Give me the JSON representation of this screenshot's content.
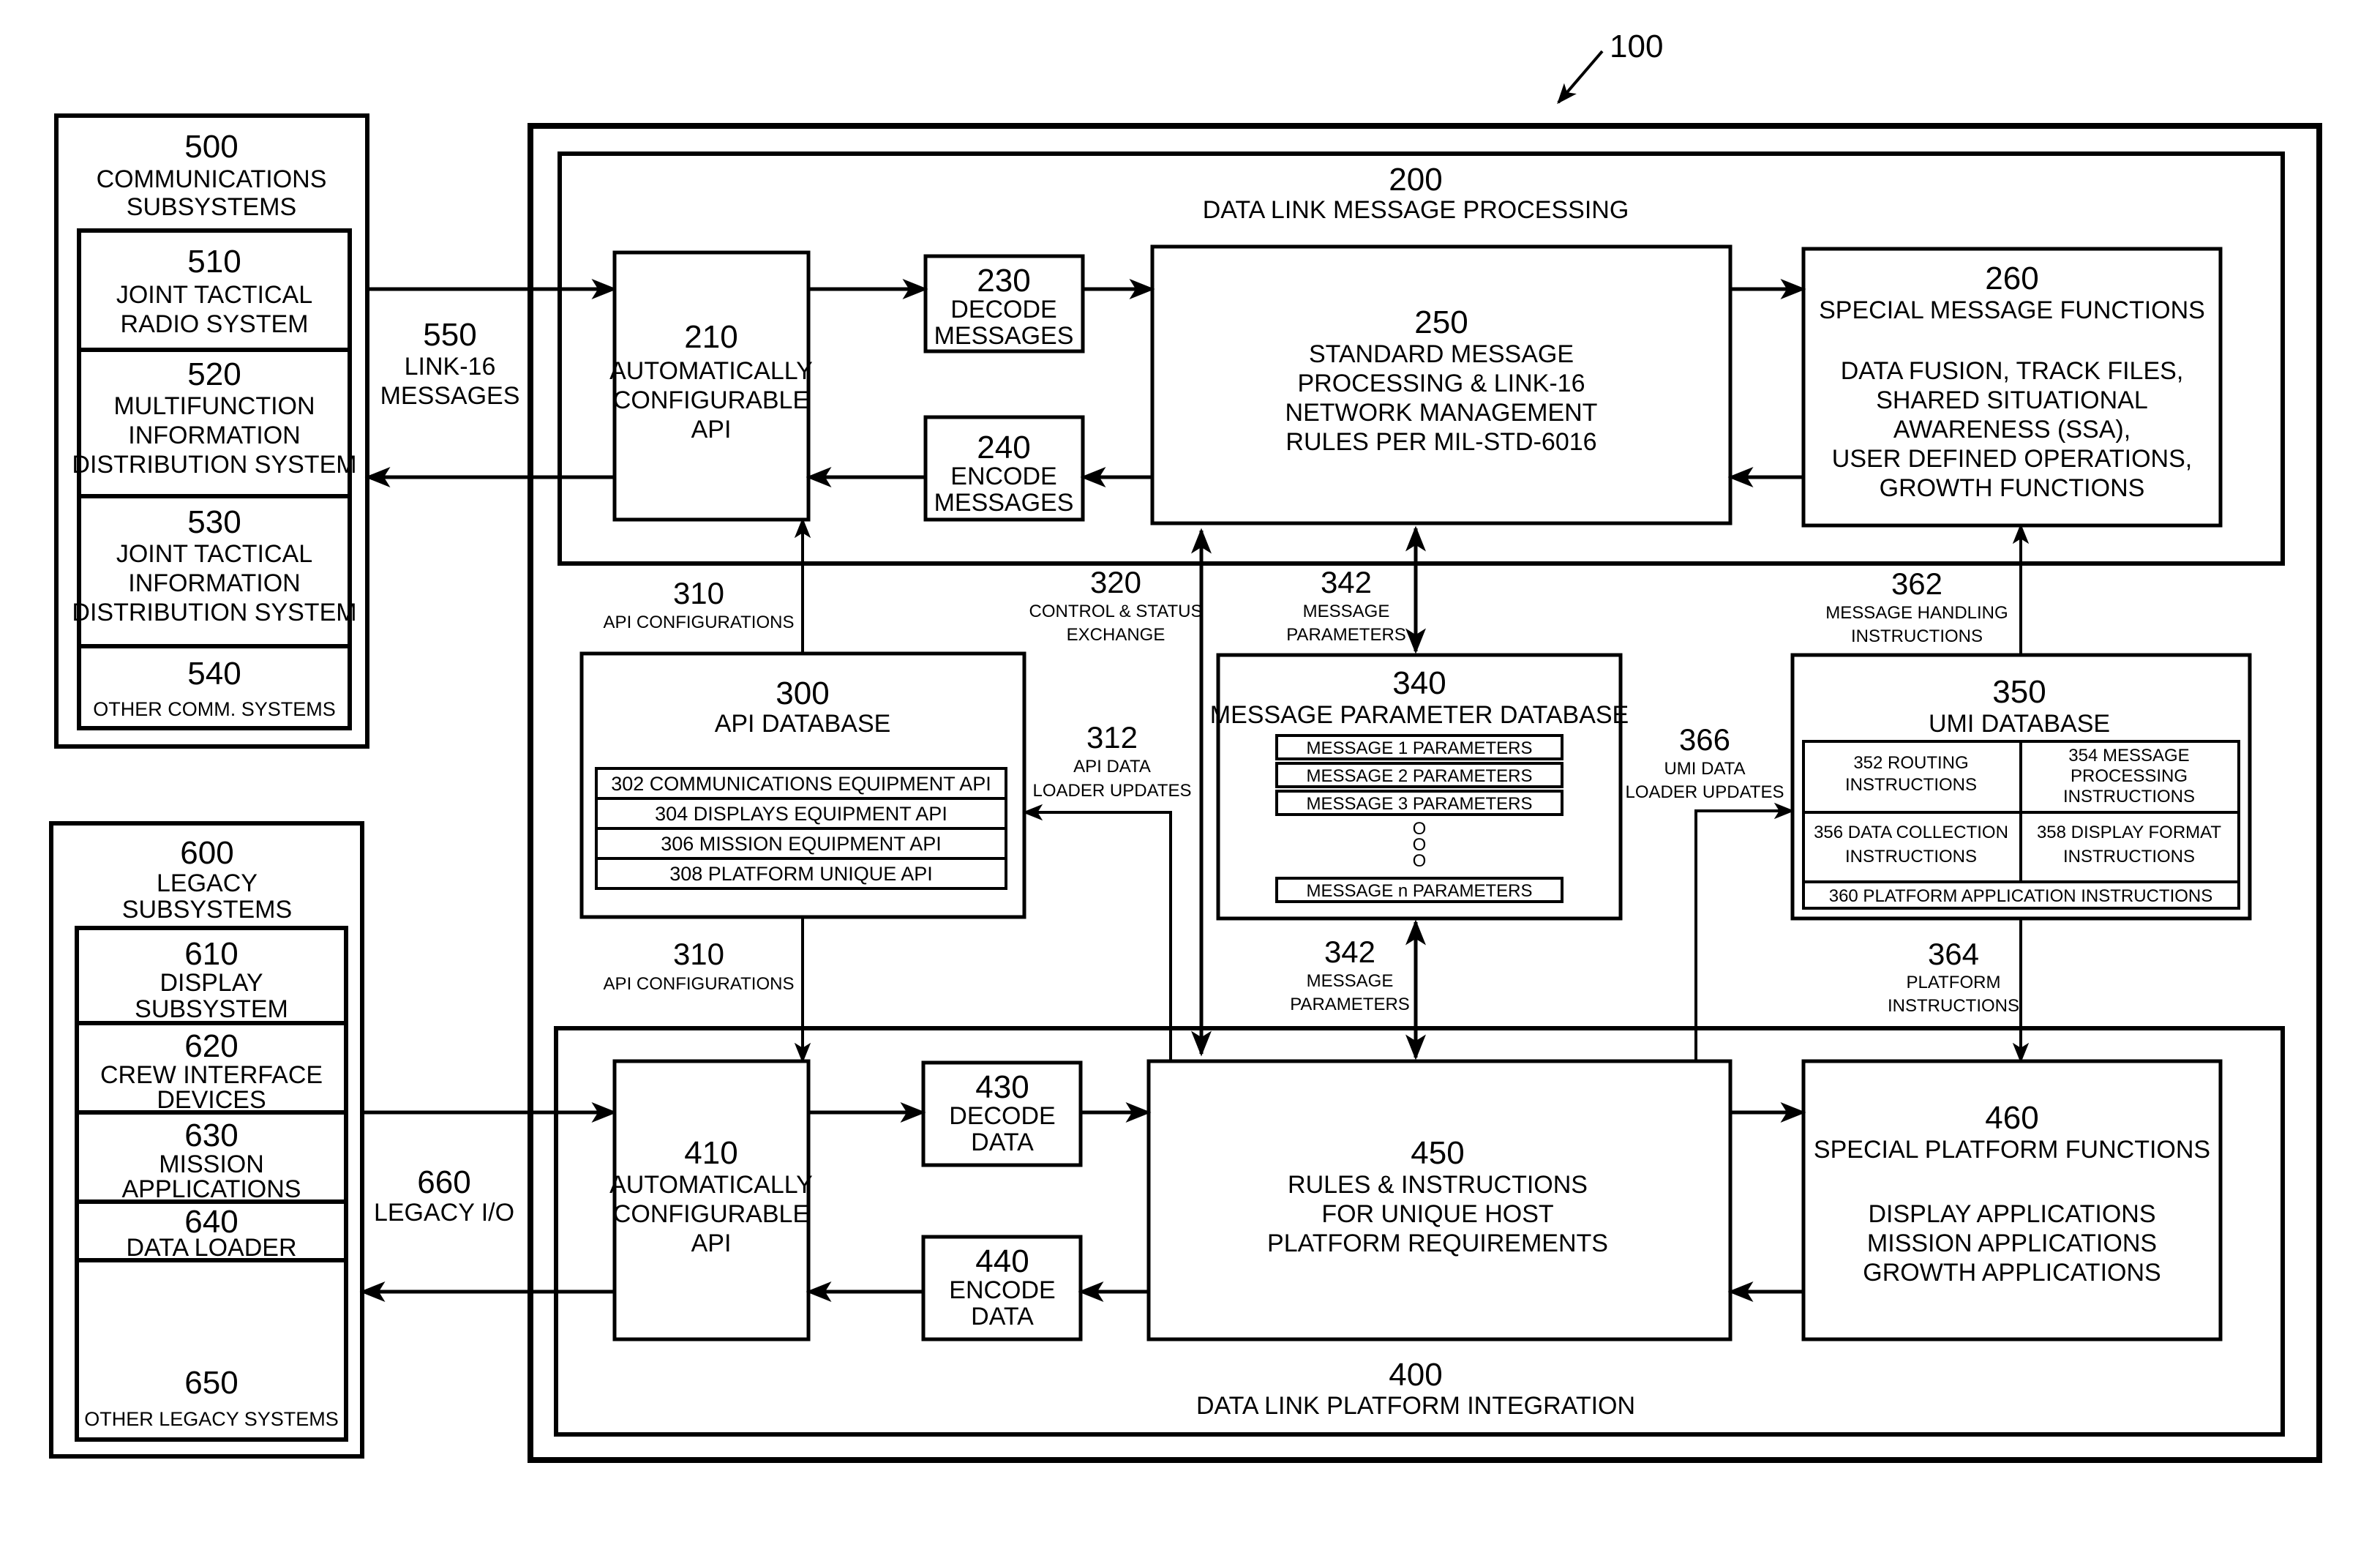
{
  "figure": {
    "reference_number": "100"
  },
  "communications": {
    "number": "500",
    "title_lines": [
      "COMMUNICATIONS",
      "SUBSYSTEMS"
    ],
    "items": [
      {
        "number": "510",
        "lines": [
          "JOINT TACTICAL",
          "RADIO SYSTEM"
        ]
      },
      {
        "number": "520",
        "lines": [
          "MULTIFUNCTION",
          "INFORMATION",
          "DISTRIBUTION SYSTEM"
        ]
      },
      {
        "number": "530",
        "lines": [
          "JOINT TACTICAL",
          "INFORMATION",
          "DISTRIBUTION SYSTEM"
        ]
      },
      {
        "number": "540",
        "lines": [
          "OTHER COMM. SYSTEMS"
        ]
      }
    ],
    "link": {
      "number": "550",
      "lines": [
        "LINK-16",
        "MESSAGES"
      ]
    }
  },
  "legacy": {
    "number": "600",
    "title_lines": [
      "LEGACY",
      "SUBSYSTEMS"
    ],
    "items": [
      {
        "number": "610",
        "lines": [
          "DISPLAY",
          "SUBSYSTEM"
        ]
      },
      {
        "number": "620",
        "lines": [
          "CREW INTERFACE",
          "DEVICES"
        ]
      },
      {
        "number": "630",
        "lines": [
          "MISSION",
          "APPLICATIONS"
        ]
      },
      {
        "number": "640",
        "lines": [
          "DATA LOADER"
        ]
      },
      {
        "number": "650",
        "lines": [
          "OTHER LEGACY SYSTEMS"
        ]
      }
    ],
    "link": {
      "number": "660",
      "lines": [
        "LEGACY I/O"
      ]
    }
  },
  "processing": {
    "number": "200",
    "title": "DATA LINK MESSAGE PROCESSING",
    "api": {
      "number": "210",
      "lines": [
        "AUTOMATICALLY",
        "CONFIGURABLE",
        "API"
      ]
    },
    "decode": {
      "number": "230",
      "lines": [
        "DECODE",
        "MESSAGES"
      ]
    },
    "encode": {
      "number": "240",
      "lines": [
        "ENCODE",
        "MESSAGES"
      ]
    },
    "standard": {
      "number": "250",
      "lines": [
        "STANDARD MESSAGE",
        "PROCESSING & LINK-16",
        "NETWORK MANAGEMENT",
        "RULES PER MIL-STD-6016"
      ]
    },
    "special": {
      "number": "260",
      "title": "SPECIAL MESSAGE FUNCTIONS",
      "lines": [
        "DATA FUSION, TRACK FILES,",
        "SHARED SITUATIONAL",
        "AWARENESS (SSA),",
        "USER DEFINED OPERATIONS,",
        "GROWTH FUNCTIONS"
      ]
    }
  },
  "databases": {
    "api_db": {
      "number": "300",
      "title": "API DATABASE",
      "rows": [
        "302 COMMUNICATIONS EQUIPMENT API",
        "304 DISPLAYS EQUIPMENT API",
        "306 MISSION EQUIPMENT API",
        "308 PLATFORM UNIQUE API"
      ]
    },
    "msg_db": {
      "number": "340",
      "title": "MESSAGE PARAMETER DATABASE",
      "rows": [
        "MESSAGE 1 PARAMETERS",
        "MESSAGE 2 PARAMETERS",
        "MESSAGE 3 PARAMETERS"
      ],
      "ellipsis": [
        "O",
        "O",
        "O"
      ],
      "last_row": "MESSAGE n PARAMETERS"
    },
    "umi_db": {
      "number": "350",
      "title": "UMI DATABASE",
      "cells": [
        {
          "number": "352",
          "lines": [
            "352 ROUTING",
            "INSTRUCTIONS"
          ]
        },
        {
          "number": "354",
          "lines": [
            "354 MESSAGE",
            "PROCESSING",
            "INSTRUCTIONS"
          ]
        },
        {
          "number": "356",
          "lines": [
            "356 DATA COLLECTION",
            "INSTRUCTIONS"
          ]
        },
        {
          "number": "358",
          "lines": [
            "358 DISPLAY FORMAT",
            "INSTRUCTIONS"
          ]
        }
      ],
      "footer": "360 PLATFORM APPLICATION INSTRUCTIONS"
    }
  },
  "connectors": {
    "api_config_top": {
      "number": "310",
      "lines": [
        "API  CONFIGURATIONS"
      ]
    },
    "api_config_bottom": {
      "number": "310",
      "lines": [
        "API CONFIGURATIONS"
      ]
    },
    "api_loader": {
      "number": "312",
      "lines": [
        "API DATA",
        "LOADER UPDATES"
      ]
    },
    "control_status": {
      "number": "320",
      "lines": [
        "CONTROL & STATUS",
        "EXCHANGE"
      ]
    },
    "msg_params_top": {
      "number": "342",
      "lines": [
        "MESSAGE",
        "PARAMETERS"
      ]
    },
    "msg_params_bottom": {
      "number": "342",
      "lines": [
        "MESSAGE",
        "PARAMETERS"
      ]
    },
    "msg_handling": {
      "number": "362",
      "lines": [
        "MESSAGE HANDLING",
        "INSTRUCTIONS"
      ]
    },
    "platform_instr": {
      "number": "364",
      "lines": [
        "PLATFORM",
        "INSTRUCTIONS"
      ]
    },
    "umi_loader": {
      "number": "366",
      "lines": [
        "UMI DATA",
        "LOADER UPDATES"
      ]
    }
  },
  "integration": {
    "number": "400",
    "title": "DATA LINK PLATFORM INTEGRATION",
    "api": {
      "number": "410",
      "lines": [
        "AUTOMATICALLY",
        "CONFIGURABLE",
        "API"
      ]
    },
    "decode": {
      "number": "430",
      "lines": [
        "DECODE",
        "DATA"
      ]
    },
    "encode": {
      "number": "440",
      "lines": [
        "ENCODE",
        "DATA"
      ]
    },
    "rules": {
      "number": "450",
      "lines": [
        "RULES & INSTRUCTIONS",
        "FOR UNIQUE HOST",
        "PLATFORM REQUIREMENTS"
      ]
    },
    "special": {
      "number": "460",
      "title": "SPECIAL PLATFORM FUNCTIONS",
      "lines": [
        "DISPLAY APPLICATIONS",
        "MISSION APPLICATIONS",
        "GROWTH APPLICATIONS"
      ]
    }
  }
}
